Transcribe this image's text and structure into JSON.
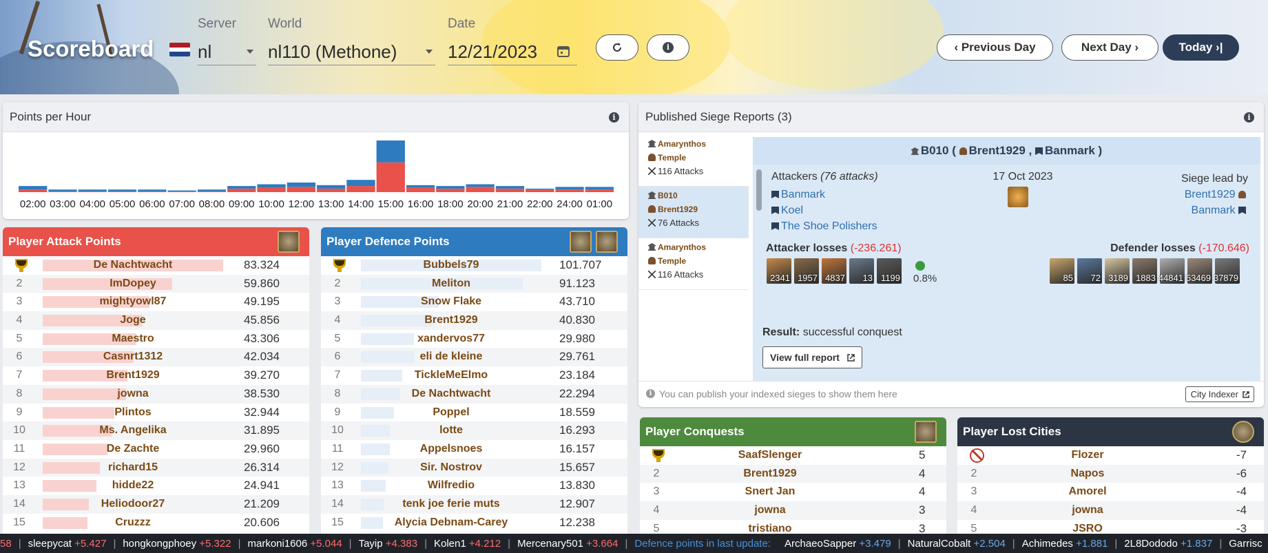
{
  "header": {
    "title": "Scoreboard",
    "server_label": "Server",
    "server_value": "nl",
    "world_label": "World",
    "world_value": "nl110 (Methone)",
    "date_label": "Date",
    "date_value": "12/21/2023",
    "prev_label": "‹ Previous Day",
    "next_label": "Next Day ›",
    "today_label": "Today ›|",
    "refresh_icon": "refresh-icon",
    "info_icon": "info-icon"
  },
  "points_per_hour": {
    "title": "Points per Hour"
  },
  "chart_data": {
    "type": "bar",
    "stacked": true,
    "categories": [
      "02:00",
      "03:00",
      "04:00",
      "05:00",
      "06:00",
      "07:00",
      "08:00",
      "09:00",
      "10:00",
      "12:00",
      "13:00",
      "14:00",
      "15:00",
      "16:00",
      "18:00",
      "20:00",
      "21:00",
      "22:00",
      "24:00",
      "01:00"
    ],
    "series": [
      {
        "color": "#e8524a",
        "values": [
          3,
          1,
          1,
          1,
          1,
          1,
          1,
          4,
          5,
          6,
          4,
          7,
          34,
          5,
          4,
          6,
          4,
          3,
          3,
          3
        ]
      },
      {
        "color": "#2e7bc0",
        "values": [
          4,
          2,
          2,
          2,
          2,
          1,
          2,
          3,
          4,
          5,
          4,
          7,
          25,
          3,
          3,
          3,
          3,
          1,
          3,
          3
        ]
      }
    ],
    "xlabel": "",
    "ylabel": "",
    "legend": false,
    "grid": false
  },
  "attack": {
    "title": "Player Attack Points",
    "color": "#e8524a",
    "bar_color": "#f9d2d0",
    "max": 83324,
    "rows": [
      {
        "rank": "1",
        "name": "De Nachtwacht",
        "value": "83.324",
        "n": 83324
      },
      {
        "rank": "2",
        "name": "ImDopey",
        "value": "59.860",
        "n": 59860
      },
      {
        "rank": "3",
        "name": "mightyowl87",
        "value": "49.195",
        "n": 49195
      },
      {
        "rank": "4",
        "name": "Joge",
        "value": "45.856",
        "n": 45856
      },
      {
        "rank": "5",
        "name": "Maestro",
        "value": "43.306",
        "n": 43306
      },
      {
        "rank": "6",
        "name": "Casnrt1312",
        "value": "42.034",
        "n": 42034
      },
      {
        "rank": "7",
        "name": "Brent1929",
        "value": "39.270",
        "n": 39270
      },
      {
        "rank": "8",
        "name": "jowna",
        "value": "38.530",
        "n": 38530
      },
      {
        "rank": "9",
        "name": "Plintos",
        "value": "32.944",
        "n": 32944
      },
      {
        "rank": "10",
        "name": "Ms. Angelika",
        "value": "31.895",
        "n": 31895
      },
      {
        "rank": "11",
        "name": "De Zachte",
        "value": "29.960",
        "n": 29960
      },
      {
        "rank": "12",
        "name": "richard15",
        "value": "26.314",
        "n": 26314
      },
      {
        "rank": "13",
        "name": "hidde22",
        "value": "24.941",
        "n": 24941
      },
      {
        "rank": "14",
        "name": "Heliodoor27",
        "value": "21.209",
        "n": 21209
      },
      {
        "rank": "15",
        "name": "Cruzzz",
        "value": "20.606",
        "n": 20606
      }
    ]
  },
  "defence": {
    "title": "Player Defence Points",
    "color": "#2e7bc0",
    "bar_color": "#e6eef8",
    "max": 101707,
    "rows": [
      {
        "rank": "1",
        "name": "Bubbels79",
        "value": "101.707",
        "n": 101707
      },
      {
        "rank": "2",
        "name": "Meliton",
        "value": "91.123",
        "n": 91123
      },
      {
        "rank": "3",
        "name": "Snow Flake",
        "value": "43.710",
        "n": 43710
      },
      {
        "rank": "4",
        "name": "Brent1929",
        "value": "40.830",
        "n": 40830
      },
      {
        "rank": "5",
        "name": "xandervos77",
        "value": "29.980",
        "n": 29980
      },
      {
        "rank": "6",
        "name": "eli de kleine",
        "value": "29.761",
        "n": 29761
      },
      {
        "rank": "7",
        "name": "TickleMeElmo",
        "value": "23.184",
        "n": 23184
      },
      {
        "rank": "8",
        "name": "De Nachtwacht",
        "value": "22.294",
        "n": 22294
      },
      {
        "rank": "9",
        "name": "Poppel",
        "value": "18.559",
        "n": 18559
      },
      {
        "rank": "10",
        "name": "lotte",
        "value": "16.293",
        "n": 16293
      },
      {
        "rank": "11",
        "name": "Appelsnoes",
        "value": "16.157",
        "n": 16157
      },
      {
        "rank": "12",
        "name": "Sir. Nostrov",
        "value": "15.657",
        "n": 15657
      },
      {
        "rank": "13",
        "name": "Wilfredio",
        "value": "13.830",
        "n": 13830
      },
      {
        "rank": "14",
        "name": "tenk joe ferie muts",
        "value": "12.907",
        "n": 12907
      },
      {
        "rank": "15",
        "name": "Alycia Debnam-Carey",
        "value": "12.238",
        "n": 12238
      }
    ]
  },
  "siege": {
    "title": "Published Siege Reports (3)",
    "list": [
      {
        "a": "Amarynthos",
        "b": "Temple",
        "c": "116 Attacks"
      },
      {
        "a": "B010",
        "b": "Brent1929",
        "c": "76 Attacks"
      },
      {
        "a": "Amarynthos",
        "b": "Temple",
        "c": "116 Attacks"
      }
    ],
    "detail": {
      "city": "B010",
      "sep1": "(",
      "owner": "Brent1929",
      "sep2": ",",
      "alliance": "Banmark",
      "sep3": ")",
      "attackers_label": "Attackers",
      "attackers_count": "(76 attacks)",
      "attackers": [
        "Banmark",
        "Koel",
        "The Shoe Polishers"
      ],
      "date": "17 Oct 2023",
      "lead_label": "Siege lead by",
      "lead_player": "Brent1929",
      "lead_alliance": "Banmark",
      "att_loss_label": "Attacker losses",
      "att_loss": "(-236.261)",
      "def_loss_label": "Defender losses",
      "def_loss": "(-170.646)",
      "att_units": [
        "2341",
        "1957",
        "4837",
        "13",
        "1199"
      ],
      "luck": "0.8%",
      "def_units": [
        "85",
        "72",
        "3189",
        "1883",
        "44841",
        "53469",
        "37879"
      ],
      "result_label": "Result:",
      "result": "successful conquest",
      "view_label": "View full report"
    },
    "footer_note": "You can publish your indexed sieges to show them here",
    "city_indexer": "City Indexer"
  },
  "conquests": {
    "title": "Player Conquests",
    "rows": [
      {
        "rank": "1",
        "name": "SaafSlenger",
        "value": "5"
      },
      {
        "rank": "2",
        "name": "Brent1929",
        "value": "4"
      },
      {
        "rank": "3",
        "name": "Snert Jan",
        "value": "4"
      },
      {
        "rank": "4",
        "name": "jowna",
        "value": "3"
      },
      {
        "rank": "5",
        "name": "tristiano",
        "value": "3"
      }
    ]
  },
  "lost": {
    "title": "Player Lost Cities",
    "rows": [
      {
        "rank": "1",
        "name": "Flozer",
        "value": "-7"
      },
      {
        "rank": "2",
        "name": "Napos",
        "value": "-6"
      },
      {
        "rank": "3",
        "name": "Amorel",
        "value": "-4"
      },
      {
        "rank": "4",
        "name": "jowna",
        "value": "-4"
      },
      {
        "rank": "5",
        "name": "JSRO",
        "value": "-3"
      }
    ]
  },
  "ticker": {
    "lead": "58",
    "attack": [
      {
        "n": "sleepycat",
        "v": "+5.427"
      },
      {
        "n": "hongkongphoey",
        "v": "+5.322"
      },
      {
        "n": "markoni1606",
        "v": "+5.044"
      },
      {
        "n": "Tayip",
        "v": "+4.383"
      },
      {
        "n": "Kolen1",
        "v": "+4.212"
      },
      {
        "n": "Mercenary501",
        "v": "+3.664"
      }
    ],
    "def_title": "Defence points in last update:",
    "defence": [
      {
        "n": "ArchaeoSapper",
        "v": "+3.479"
      },
      {
        "n": "NaturalCobalt",
        "v": "+2.504"
      },
      {
        "n": "Achimedes",
        "v": "+1.881"
      },
      {
        "n": "2L8Dododo",
        "v": "+1.837"
      }
    ],
    "tail": "Garrisc"
  }
}
